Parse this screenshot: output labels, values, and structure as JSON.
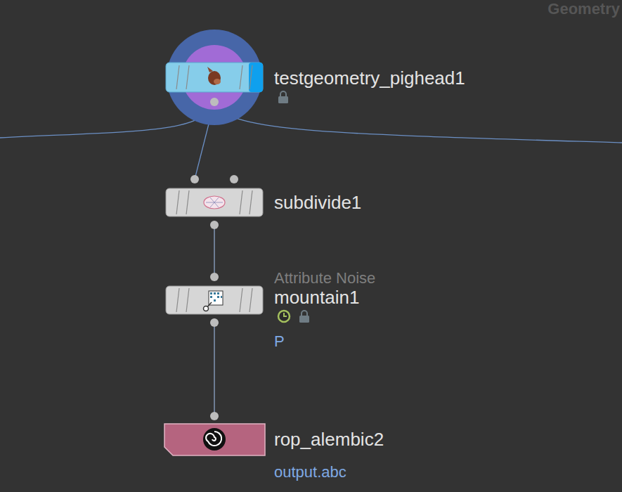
{
  "network": {
    "context": "Geometry"
  },
  "nodes": [
    {
      "name": "testgeometry_pighead1",
      "kind": "display",
      "locked": true,
      "time_dependent": false,
      "offscreen_links": [
        "left",
        "right"
      ]
    },
    {
      "name": "subdivide1",
      "kind": "sop",
      "locked": false,
      "time_dependent": false,
      "offscreen_links": []
    },
    {
      "name": "mountain1",
      "kind": "sop",
      "type_label": "Attribute Noise",
      "locked": true,
      "time_dependent": true,
      "info": "P",
      "offscreen_links": []
    },
    {
      "name": "rop_alembic2",
      "kind": "rop",
      "locked": false,
      "time_dependent": false,
      "info": "output.abc",
      "offscreen_links": []
    }
  ],
  "connections": [
    {
      "from": "testgeometry_pighead1",
      "to": "subdivide1"
    },
    {
      "from": "subdivide1",
      "to": "mountain1"
    },
    {
      "from": "mountain1",
      "to": "rop_alembic2"
    }
  ]
}
